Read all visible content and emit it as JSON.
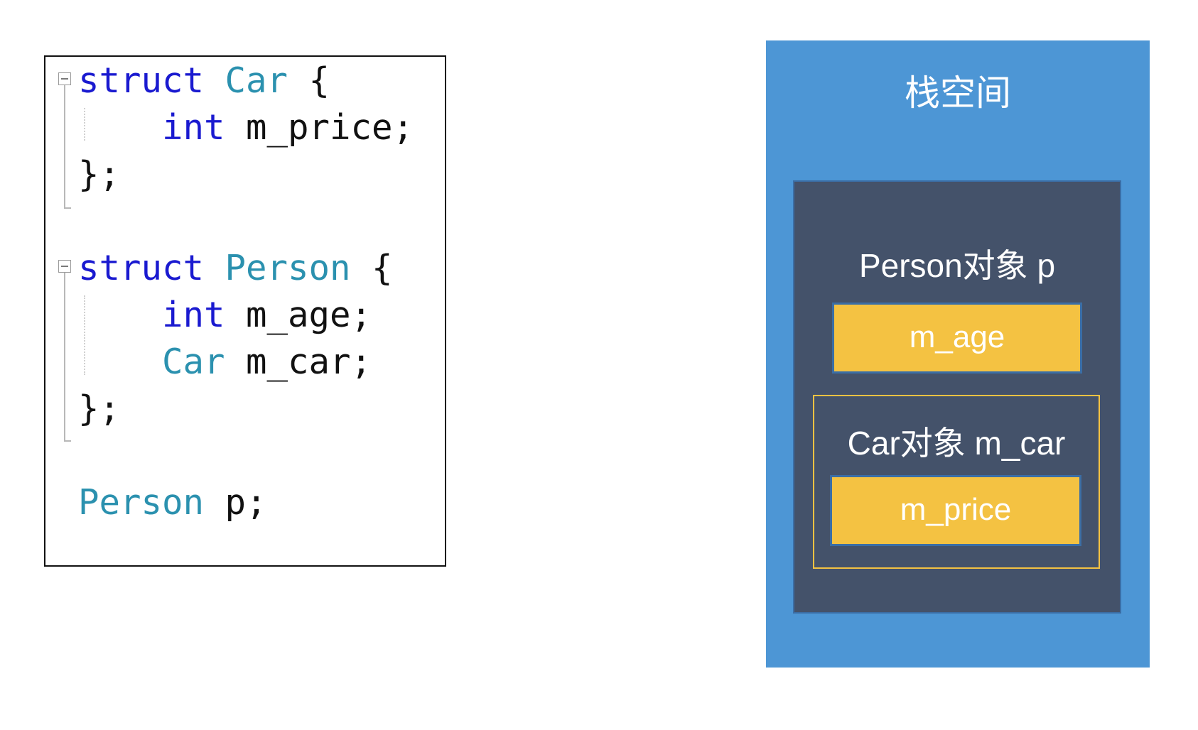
{
  "code": {
    "lines": [
      [
        {
          "t": "struct",
          "c": "kw"
        },
        {
          "t": " ",
          "c": "plain"
        },
        {
          "t": "Car",
          "c": "ty"
        },
        {
          "t": " {",
          "c": "plain"
        }
      ],
      [
        {
          "t": "    ",
          "c": "plain"
        },
        {
          "t": "int",
          "c": "kw"
        },
        {
          "t": " m_price;",
          "c": "plain"
        }
      ],
      [
        {
          "t": "};",
          "c": "plain"
        }
      ],
      [],
      [
        {
          "t": "struct",
          "c": "kw"
        },
        {
          "t": " ",
          "c": "plain"
        },
        {
          "t": "Person",
          "c": "ty"
        },
        {
          "t": " {",
          "c": "plain"
        }
      ],
      [
        {
          "t": "    ",
          "c": "plain"
        },
        {
          "t": "int",
          "c": "kw"
        },
        {
          "t": " m_age;",
          "c": "plain"
        }
      ],
      [
        {
          "t": "    ",
          "c": "plain"
        },
        {
          "t": "Car",
          "c": "ty"
        },
        {
          "t": " m_car;",
          "c": "plain"
        }
      ],
      [
        {
          "t": "};",
          "c": "plain"
        }
      ],
      [],
      [
        {
          "t": "Person",
          "c": "ty"
        },
        {
          "t": " p;",
          "c": "plain"
        }
      ]
    ]
  },
  "diagram": {
    "stack_title": "栈空间",
    "person_label": "Person对象 p",
    "age_field": "m_age",
    "car_label": "Car对象 m_car",
    "price_field": "m_price"
  },
  "colors": {
    "keyword": "#1a1ad0",
    "type": "#2b91af",
    "stack_bg": "#4d96d5",
    "object_bg": "#44526a",
    "field_bg": "#f4c242"
  }
}
